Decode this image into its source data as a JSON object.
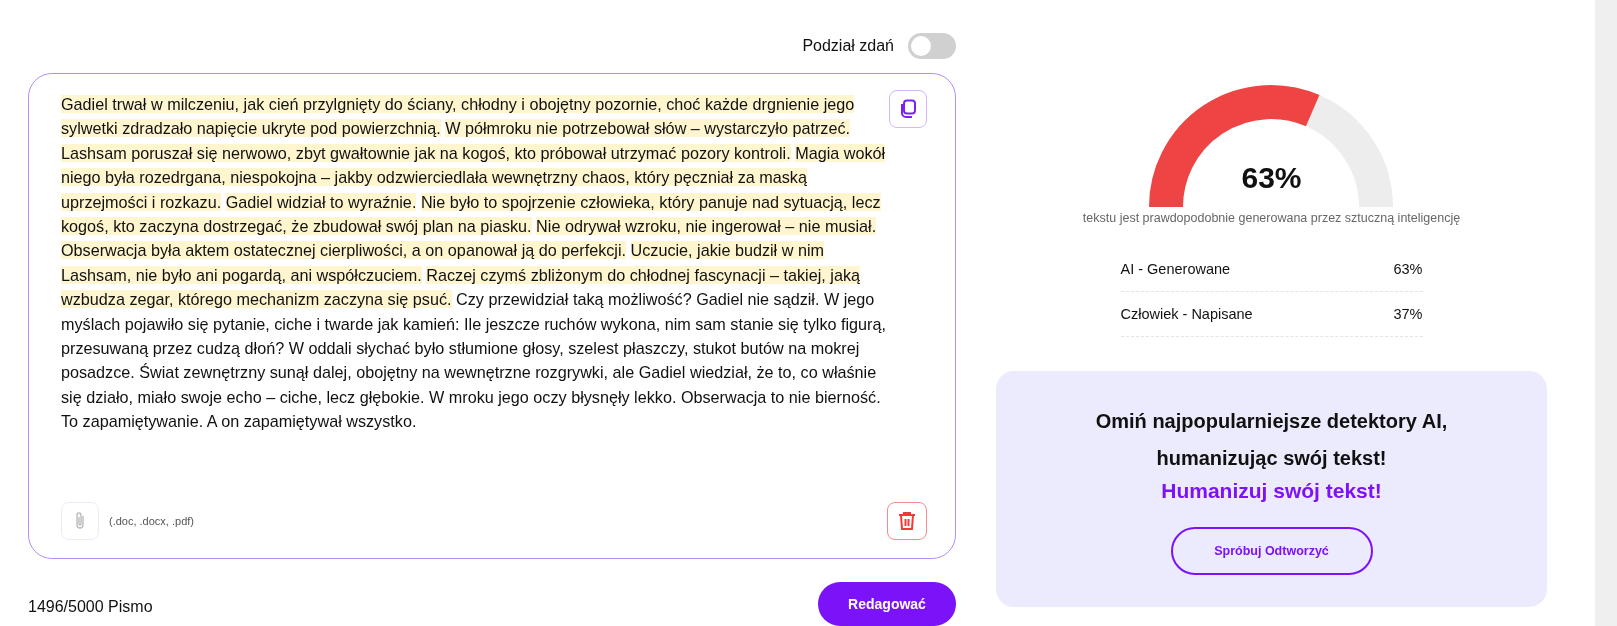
{
  "sentence_split": {
    "label": "Podział zdań",
    "on": false
  },
  "editor": {
    "segments": [
      {
        "text": "Gadiel trwał w milczeniu, jak cień przylgnięty do ściany, chłodny i obojętny pozornie, choć każde drgnienie jego sylwetki zdradzało napięcie ukryte pod powierzchnią.",
        "highlighted": true
      },
      {
        "text": "W półmroku nie potrzebował słów – wystarczyło patrzeć.",
        "highlighted": true
      },
      {
        "text": "Lashsam poruszał się nerwowo, zbyt gwałtownie jak na kogoś, kto próbował utrzymać pozory kontroli.",
        "highlighted": true
      },
      {
        "text": "Magia wokół niego była rozedrgana, niespokojna – jakby odzwierciedlała wewnętrzny chaos, który pęczniał za maską uprzejmości i rozkazu.",
        "highlighted": true
      },
      {
        "text": "Gadiel widział to wyraźnie.",
        "highlighted": true
      },
      {
        "text": "Nie było to spojrzenie człowieka, który panuje nad sytuacją, lecz kogoś, kto zaczyna dostrzegać, że zbudował swój plan na piasku.",
        "highlighted": true
      },
      {
        "text": "Nie odrywał wzroku, nie ingerował – nie musiał.",
        "highlighted": true
      },
      {
        "text": "Obserwacja była aktem ostatecznej cierpliwości, a on opanował ją do perfekcji.",
        "highlighted": true
      },
      {
        "text": "Uczucie, jakie budził w nim Lashsam, nie było ani pogardą, ani współczuciem.",
        "highlighted": true
      },
      {
        "text": "Raczej czymś zbliżonym do chłodnej fascynacji – takiej, jaką wzbudza zegar, którego mechanizm zaczyna się psuć.",
        "highlighted": true
      },
      {
        "text": "Czy przewidział taką możliwość? Gadiel nie sądził. W jego myślach pojawiło się pytanie, ciche i twarde jak kamień: Ile jeszcze ruchów wykona, nim sam stanie się tylko figurą, przesuwaną przez cudzą dłoń? W oddali słychać było stłumione głosy, szelest płaszczy, stukot butów na mokrej posadzce. Świat zewnętrzny sunął dalej, obojętny na wewnętrzne rozgrywki, ale Gadiel wiedział, że to, co właśnie się działo, miało swoje echo – ciche, lecz głębokie. W mroku jego oczy błysnęły lekko. Obserwacja to nie bierność. To zapamiętywanie. A on zapamiętywał wszystko.",
        "highlighted": false
      }
    ],
    "file_types": "(.doc, .docx, .pdf)"
  },
  "counter": "1496/5000 Pismo",
  "submit_button": "Redagować",
  "result": {
    "percent": "63%",
    "caption": "tekstu jest prawdopodobnie generowana przez sztuczną inteligencję",
    "rows": [
      {
        "label": "AI - Generowane",
        "value": "63%"
      },
      {
        "label": "Człowiek - Napisane",
        "value": "37%"
      }
    ]
  },
  "promo": {
    "heading": "Omiń najpopularniejsze detektory AI, humanizując swój tekst!",
    "highlight": "Humanizuj swój tekst!",
    "button": "Spróbuj Odtworzyć"
  }
}
